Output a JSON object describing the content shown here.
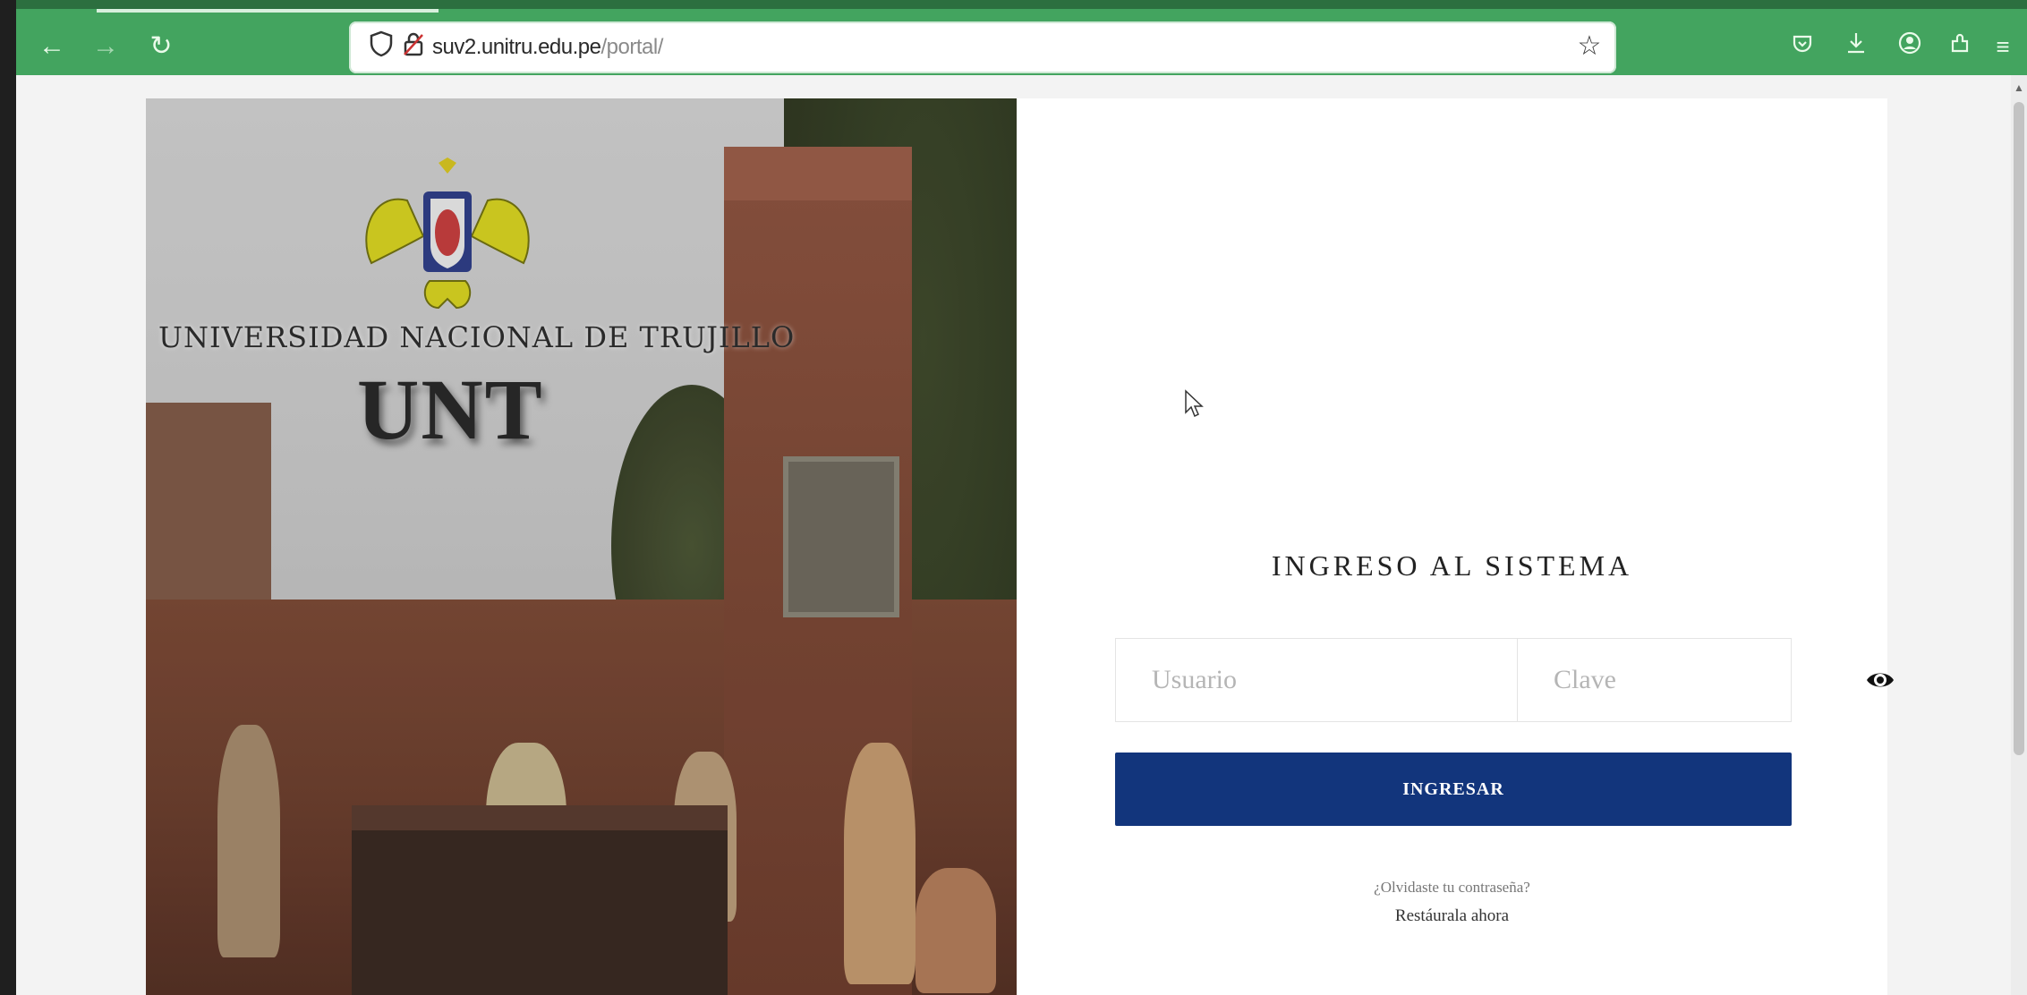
{
  "browser": {
    "url_host": "suv2.unitru.edu.pe",
    "url_path": "/portal/",
    "url_prefix": "",
    "icons": [
      "back-arrow-icon",
      "forward-arrow-icon",
      "reload-icon",
      "shield-icon",
      "lock-icon",
      "star-icon",
      "pocket-icon",
      "download-icon",
      "account-icon",
      "extensions-icon",
      "menu-icon"
    ]
  },
  "hero": {
    "university_name": "Universidad Nacional de Trujillo",
    "abbreviation": "UNT"
  },
  "login": {
    "title": "INGRESO AL SISTEMA",
    "user_placeholder": "Usuario",
    "password_placeholder": "Clave",
    "submit_label": "INGRESAR",
    "forgot_text": "¿Olvidaste tu contraseña?",
    "restore_link": "Restáurala ahora"
  },
  "colors": {
    "toolbar": "#43a45f",
    "button": "#12357c"
  }
}
